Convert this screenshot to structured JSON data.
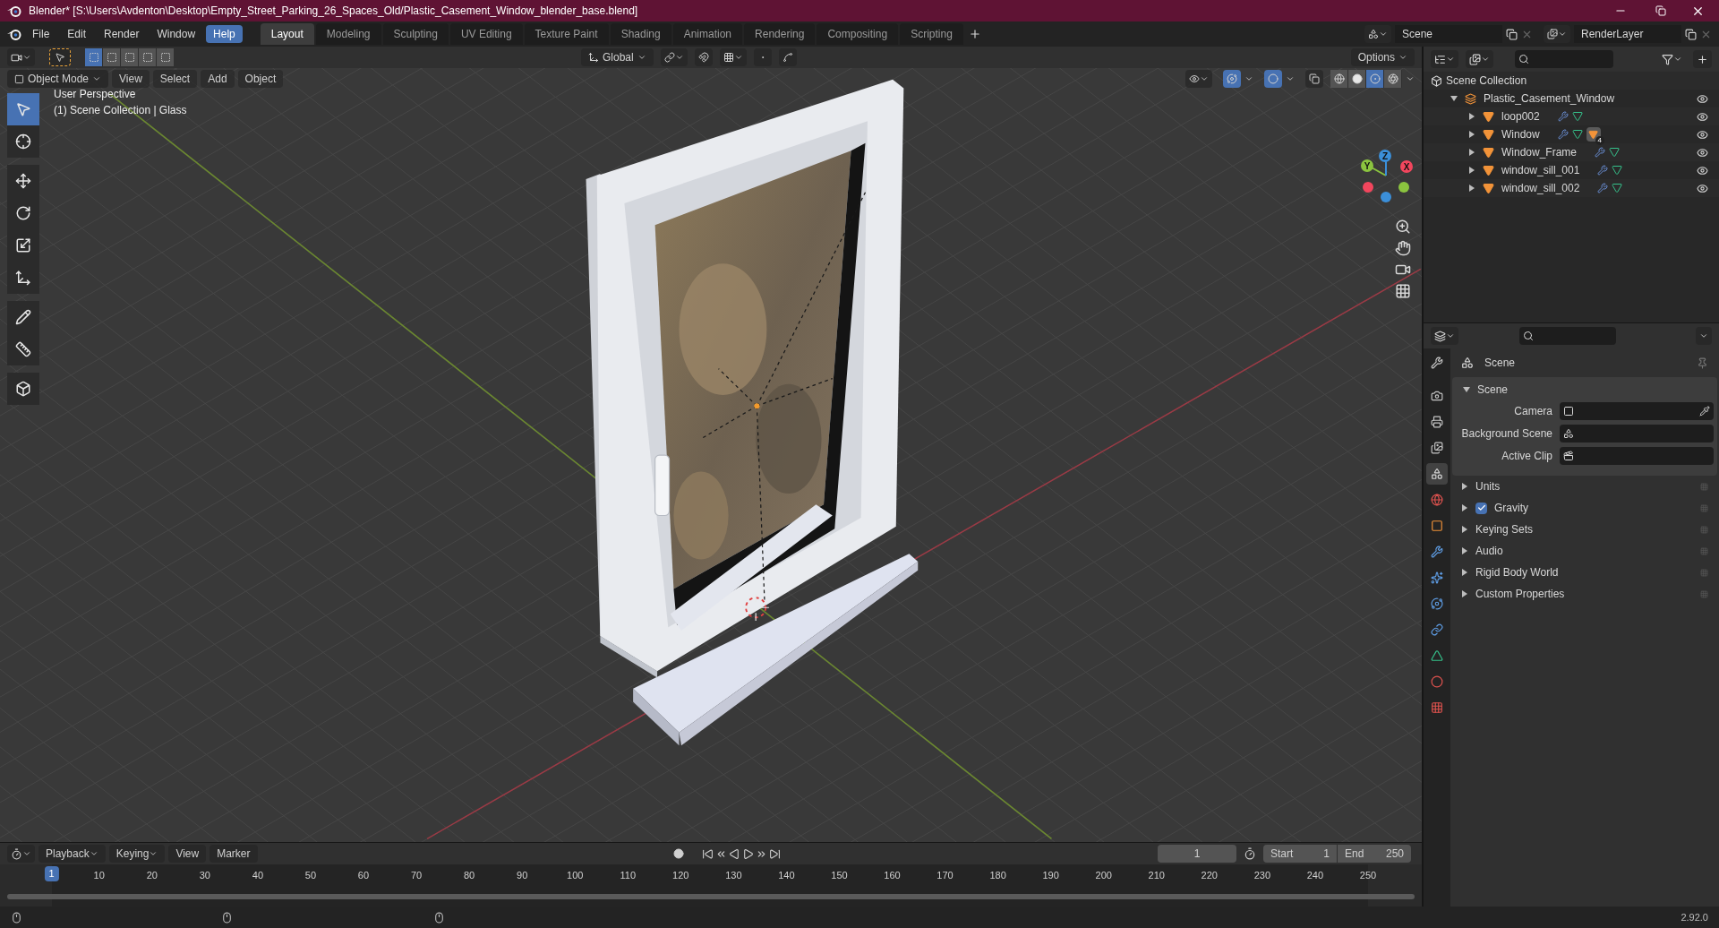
{
  "window": {
    "title": "Blender* [S:\\Users\\Avdenton\\Desktop\\Empty_Street_Parking_26_Spaces_Old/Plastic_Casement_Window_blender_base.blend]"
  },
  "menu": [
    {
      "label": "File",
      "selected": false
    },
    {
      "label": "Edit",
      "selected": false
    },
    {
      "label": "Render",
      "selected": false
    },
    {
      "label": "Window",
      "selected": false
    },
    {
      "label": "Help",
      "selected": true
    }
  ],
  "workspaces": [
    {
      "label": "Layout",
      "selected": true
    },
    {
      "label": "Modeling",
      "selected": false
    },
    {
      "label": "Sculpting",
      "selected": false
    },
    {
      "label": "UV Editing",
      "selected": false
    },
    {
      "label": "Texture Paint",
      "selected": false
    },
    {
      "label": "Shading",
      "selected": false
    },
    {
      "label": "Animation",
      "selected": false
    },
    {
      "label": "Rendering",
      "selected": false
    },
    {
      "label": "Compositing",
      "selected": false
    },
    {
      "label": "Scripting",
      "selected": false
    }
  ],
  "scene_field": "Scene",
  "view_layer_field": "RenderLayer",
  "viewport": {
    "select_modes": [
      {
        "selected": true
      },
      {
        "selected": false
      },
      {
        "selected": false
      },
      {
        "selected": false
      },
      {
        "selected": false
      }
    ],
    "orientation": "Global",
    "options": "Options",
    "mode": "Object Mode",
    "menus": [
      "View",
      "Select",
      "Add",
      "Object"
    ],
    "gizmos_on": true,
    "overlays_on": true,
    "xray": false,
    "shading": [
      {
        "kind": "wireframe",
        "selected": false
      },
      {
        "kind": "solid",
        "selected": false
      },
      {
        "kind": "material",
        "selected": true
      },
      {
        "kind": "rendered",
        "selected": false
      }
    ],
    "overlay_text": [
      "User Perspective",
      "(1) Scene Collection | Glass"
    ],
    "tools": [
      {
        "kind": "select",
        "selected": true
      },
      {
        "kind": "cursor",
        "selected": false
      },
      {
        "kind": "move",
        "selected": false
      },
      {
        "kind": "rotate",
        "selected": false
      },
      {
        "kind": "scale",
        "selected": false
      },
      {
        "kind": "transform",
        "selected": false
      },
      {
        "kind": "annotate",
        "selected": false
      },
      {
        "kind": "measure",
        "selected": false
      },
      {
        "kind": "add_cube",
        "selected": false
      }
    ],
    "gizmo_axes": [
      {
        "label": "Y",
        "color": "#8bc43f"
      },
      {
        "label": "Z",
        "color": "#3b8fd9"
      },
      {
        "label": "X",
        "color": "#f2465d"
      }
    ]
  },
  "outliner": {
    "root": "Scene Collection",
    "collection": {
      "name": "Plastic_Casement_Window",
      "expanded": true,
      "children": [
        {
          "name": "loop002",
          "expanded": false
        },
        {
          "name": "Window",
          "expanded": false,
          "material_count": "4"
        },
        {
          "name": "Window_Frame",
          "expanded": false
        },
        {
          "name": "window_sill_001",
          "expanded": false
        },
        {
          "name": "window_sill_002",
          "expanded": false
        }
      ]
    }
  },
  "properties": {
    "tabs": [
      {
        "kind": "tool",
        "selected": false
      },
      {
        "kind": "render",
        "selected": false
      },
      {
        "kind": "output",
        "selected": false
      },
      {
        "kind": "view_layer",
        "selected": false
      },
      {
        "kind": "scene",
        "selected": true
      },
      {
        "kind": "world",
        "selected": false
      },
      {
        "kind": "object",
        "selected": false
      },
      {
        "kind": "modifiers",
        "selected": false
      },
      {
        "kind": "particles",
        "selected": false
      },
      {
        "kind": "physics",
        "selected": false
      },
      {
        "kind": "constraints",
        "selected": false
      },
      {
        "kind": "data",
        "selected": false
      },
      {
        "kind": "material",
        "selected": false
      },
      {
        "kind": "texture",
        "selected": false
      }
    ],
    "header": "Scene",
    "panel": {
      "title": "Scene",
      "expanded": true,
      "fields": [
        {
          "label": "Camera",
          "kind": "camera"
        },
        {
          "label": "Background Scene",
          "kind": "scene"
        },
        {
          "label": "Active Clip",
          "kind": "clip"
        }
      ]
    },
    "sections": [
      {
        "label": "Units",
        "kind": "plain",
        "expanded": false
      },
      {
        "label": "Gravity",
        "kind": "checkbox",
        "checked": true,
        "expanded": false
      },
      {
        "label": "Keying Sets",
        "kind": "plain",
        "expanded": false
      },
      {
        "label": "Audio",
        "kind": "plain",
        "expanded": false
      },
      {
        "label": "Rigid Body World",
        "kind": "plain",
        "expanded": false
      },
      {
        "label": "Custom Properties",
        "kind": "plain",
        "expanded": false
      }
    ]
  },
  "timeline": {
    "menus": [
      "Playback",
      "Keying",
      "View",
      "Marker"
    ],
    "current_frame": "1",
    "start_label": "Start",
    "start": "1",
    "end_label": "End",
    "end": "250",
    "playhead": "1",
    "ruler": [
      "10",
      "20",
      "30",
      "40",
      "50",
      "60",
      "70",
      "80",
      "90",
      "100",
      "110",
      "120",
      "130",
      "140",
      "150",
      "160",
      "170",
      "180",
      "190",
      "200",
      "210",
      "220",
      "230",
      "240",
      "250"
    ]
  },
  "status_bar": {
    "version": "2.92.0"
  }
}
